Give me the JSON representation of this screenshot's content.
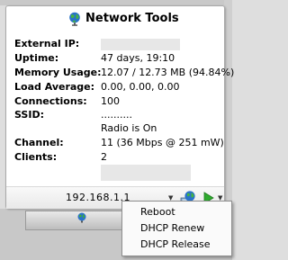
{
  "gadget": {
    "title": "Network Tools",
    "title_icon": "globe-icon"
  },
  "stats": {
    "external_ip": {
      "label": "External IP:",
      "value": ""
    },
    "uptime": {
      "label": "Uptime:",
      "value": "47 days, 19:10"
    },
    "memory_usage": {
      "label": "Memory Usage:",
      "value": "12.07 / 12.73 MB (94.84%)"
    },
    "load_average": {
      "label": "Load Average:",
      "value": "0.00, 0.00, 0.00"
    },
    "connections": {
      "label": "Connections:",
      "value": "100"
    },
    "ssid": {
      "label": "SSID:",
      "value": "..........",
      "status": "Radio is On"
    },
    "channel": {
      "label": "Channel:",
      "value": "11 (36 Mbps @ 251 mW)"
    },
    "clients": {
      "label": "Clients:",
      "value": "2"
    }
  },
  "footer": {
    "ip_address": "192.168.1.1",
    "router_button_icon": "globe-network-icon",
    "action_button_icon": "play-icon"
  },
  "menu": {
    "items": [
      "Reboot",
      "DHCP Renew",
      "DHCP Release"
    ]
  },
  "colors": {
    "play_green": "#2eaa2e",
    "globe_blue": "#2a73c9"
  }
}
